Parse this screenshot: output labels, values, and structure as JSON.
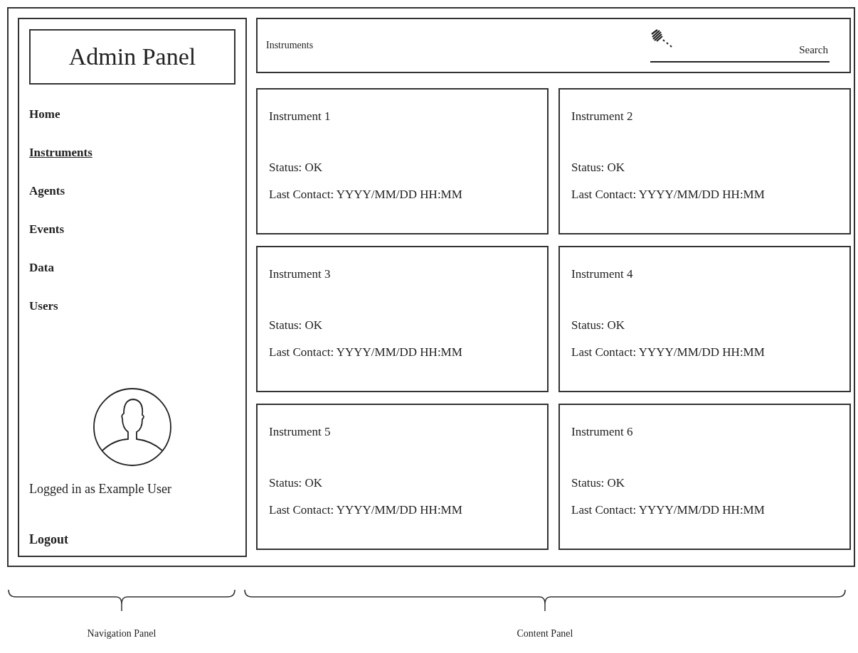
{
  "sidebar": {
    "title": "Admin Panel",
    "items": [
      {
        "label": "Home",
        "selected": false
      },
      {
        "label": "Instruments",
        "selected": true
      },
      {
        "label": "Agents",
        "selected": false
      },
      {
        "label": "Events",
        "selected": false
      },
      {
        "label": "Data",
        "selected": false
      },
      {
        "label": "Users",
        "selected": false
      }
    ],
    "user_label": "Logged in as Example User",
    "logout": "Logout"
  },
  "header": {
    "breadcrumb": "Instruments",
    "search": {
      "placeholder": "Search"
    }
  },
  "cards": [
    {
      "title": "Instrument 1",
      "status": "Status: OK",
      "last_contact": "Last Contact: YYYY/MM/DD HH:MM"
    },
    {
      "title": "Instrument 2",
      "status": "Status: OK",
      "last_contact": "Last Contact: YYYY/MM/DD HH:MM"
    },
    {
      "title": "Instrument 3",
      "status": "Status: OK",
      "last_contact": "Last Contact: YYYY/MM/DD HH:MM"
    },
    {
      "title": "Instrument 4",
      "status": "Status: OK",
      "last_contact": "Last Contact: YYYY/MM/DD HH:MM"
    },
    {
      "title": "Instrument 5",
      "status": "Status: OK",
      "last_contact": "Last Contact: YYYY/MM/DD HH:MM"
    },
    {
      "title": "Instrument 6",
      "status": "Status: OK",
      "last_contact": "Last Contact: YYYY/MM/DD HH:MM"
    }
  ],
  "annotations": [
    {
      "label": "Navigation Panel"
    },
    {
      "label": "Content Panel"
    }
  ]
}
